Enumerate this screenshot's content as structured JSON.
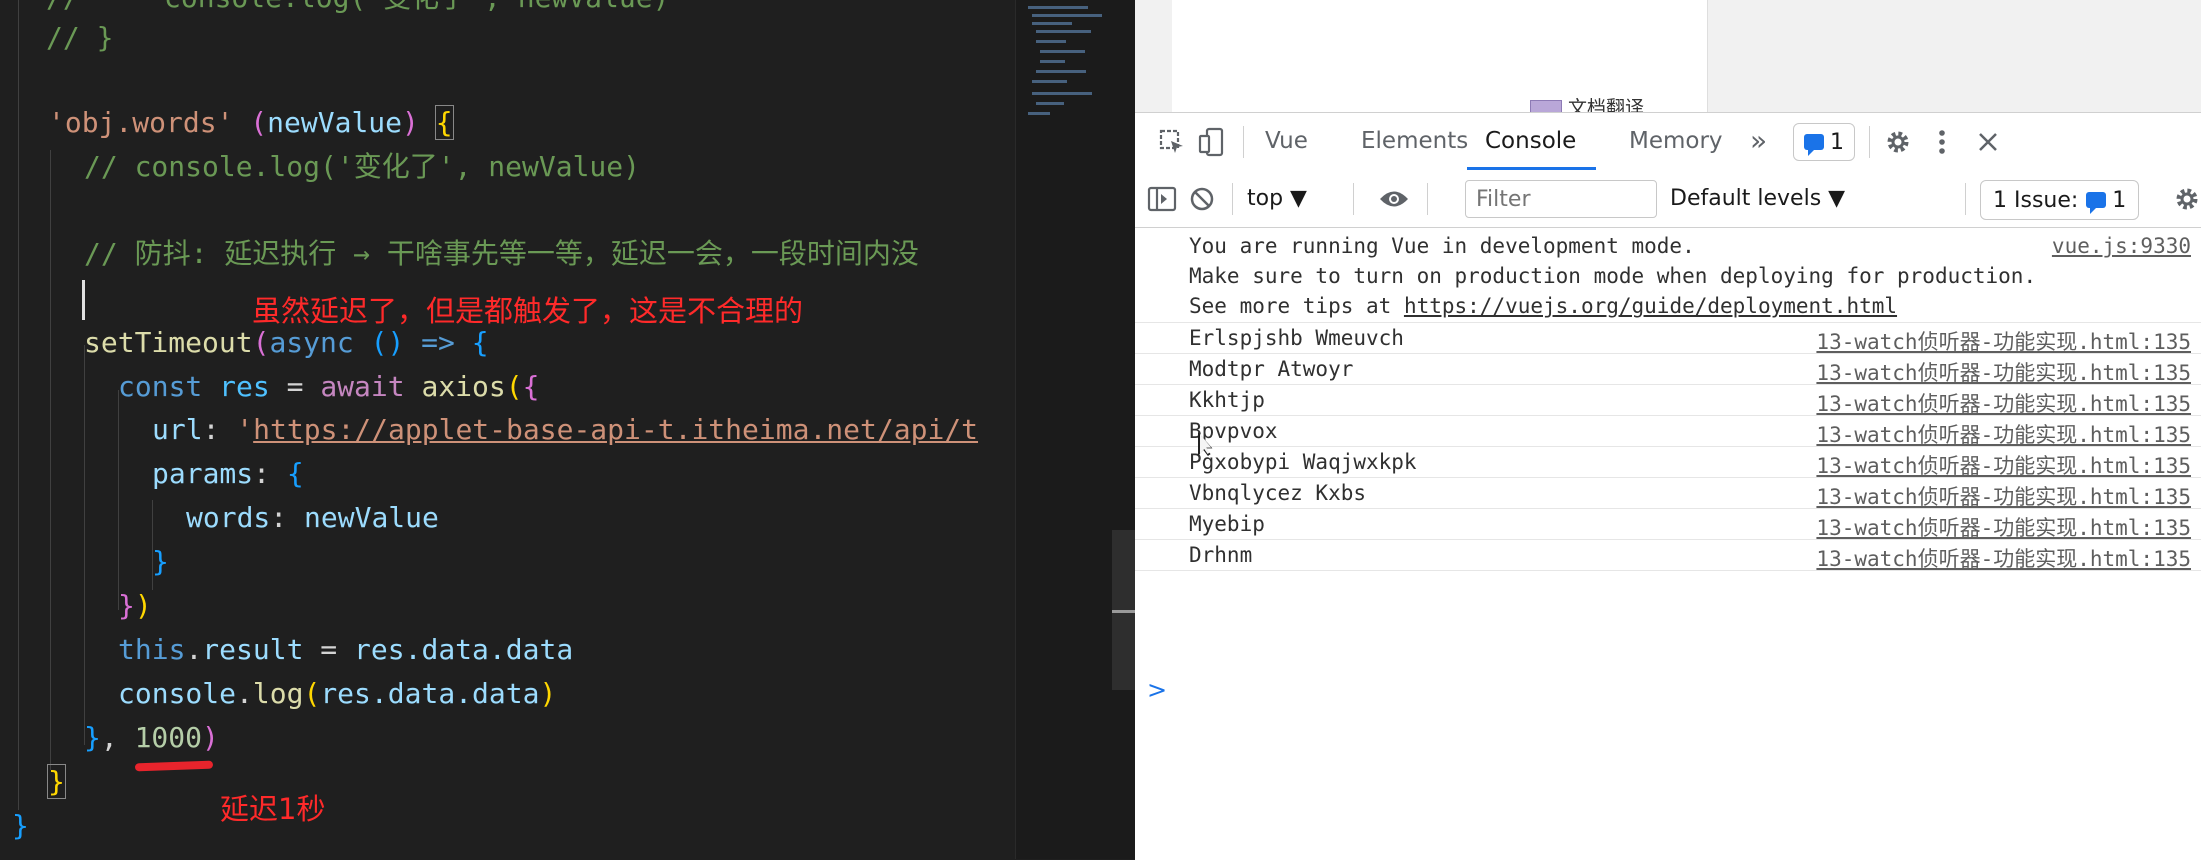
{
  "editor": {
    "top_partial": "//     console.log('变化了', newValue)",
    "comment_close": "// }",
    "watch_key": "'obj.words'",
    "param": "newValue",
    "comment_log": "// console.log('变化了', newValue)",
    "comment_debounce": "// 防抖: 延迟执行 → 干啥事先等一等，延迟一会，一段时间内没",
    "fn_setTimeout": "setTimeout",
    "kw_async": "async",
    "kw_const": "const",
    "var_res": "res",
    "kw_await": "await",
    "fn_axios": "axios",
    "prop_url": "url",
    "url_value": "https://applet-base-api-t.itheima.net/api/t",
    "prop_params": "params",
    "prop_words": "words",
    "kw_this": "this",
    "prop_result": "result",
    "expr_res_data": "res.data.data",
    "obj_console": "console",
    "fn_log": "log",
    "delay": "1000"
  },
  "annotations": {
    "note_unreasonable": "虽然延迟了，但是都触发了，这是不合理的",
    "note_delay": "延迟1秒"
  },
  "page": {
    "partial_text": "文档翻译"
  },
  "devtools": {
    "tabs": [
      "Vue",
      "Elements",
      "Console",
      "Memory"
    ],
    "active_tab": "Console",
    "more_tabs": "»",
    "message_count": "1",
    "context": "top ▼",
    "filter_placeholder": "Filter",
    "levels": "Default levels ▼",
    "issues_label": "1 Issue:",
    "issues_count": "1"
  },
  "console": {
    "vue_notice": {
      "line1": "You are running Vue in development mode.",
      "line2": "Make sure to turn on production mode when deploying for production.",
      "line3_prefix": "See more tips at ",
      "line3_link": "https://vuejs.org/guide/deployment.html",
      "source": "vue.js:9330"
    },
    "logs": [
      {
        "message": "Erlspjshb Wmeuvch",
        "source": "13-watch侦听器-功能实现.html:135"
      },
      {
        "message": "Modtpr Atwoyr",
        "source": "13-watch侦听器-功能实现.html:135"
      },
      {
        "message": "Kkhtjp",
        "source": "13-watch侦听器-功能实现.html:135"
      },
      {
        "message": "Bpvpvox",
        "source": "13-watch侦听器-功能实现.html:135"
      },
      {
        "message": "Pgxobypi Waqjwxkpk",
        "source": "13-watch侦听器-功能实现.html:135"
      },
      {
        "message": "Vbnqlycez Kxbs",
        "source": "13-watch侦听器-功能实现.html:135"
      },
      {
        "message": "Myebip",
        "source": "13-watch侦听器-功能实现.html:135"
      },
      {
        "message": "Drhnm",
        "source": "13-watch侦听器-功能实现.html:135"
      }
    ],
    "prompt": ">"
  },
  "colors": {
    "annotation_red": "#ff2a2a",
    "devtools_blue": "#1a73e8",
    "editor_bg": "#1f1f1f"
  }
}
